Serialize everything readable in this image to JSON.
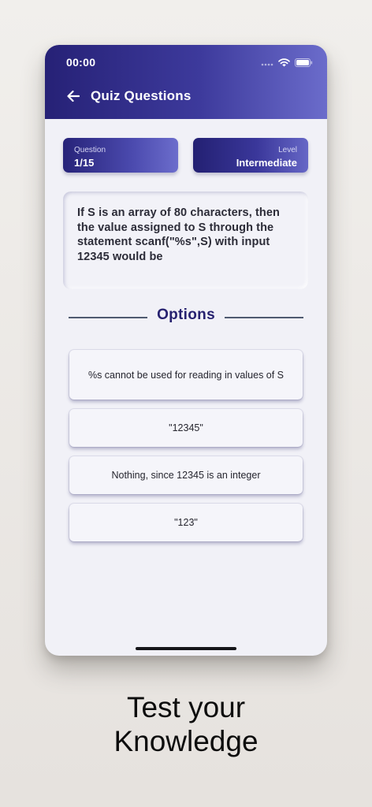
{
  "status_bar": {
    "time": "00:00"
  },
  "header": {
    "title": "Quiz Questions"
  },
  "stats": {
    "question_label": "Question",
    "question_value": "1/15",
    "level_label": "Level",
    "level_value": "Intermediate"
  },
  "question": {
    "text": "If S is an array of 80 characters, then the value assigned to S through the statement scanf(\"%s\",S) with input 12345 would be"
  },
  "options_heading": "Options",
  "options": [
    "%s cannot be used for reading in values of S",
    "\"12345\"",
    "Nothing, since 12345 is an integer",
    "\"123\""
  ],
  "tagline": {
    "line1": "Test your",
    "line2": "Knowledge"
  },
  "colors": {
    "header_start": "#262176",
    "header_end": "#6b6ccb",
    "accent_text": "#272270",
    "screen_bg": "#f1f1f7"
  },
  "icons": [
    "signal-icon",
    "wifi-icon",
    "battery-icon",
    "back-arrow-icon"
  ]
}
